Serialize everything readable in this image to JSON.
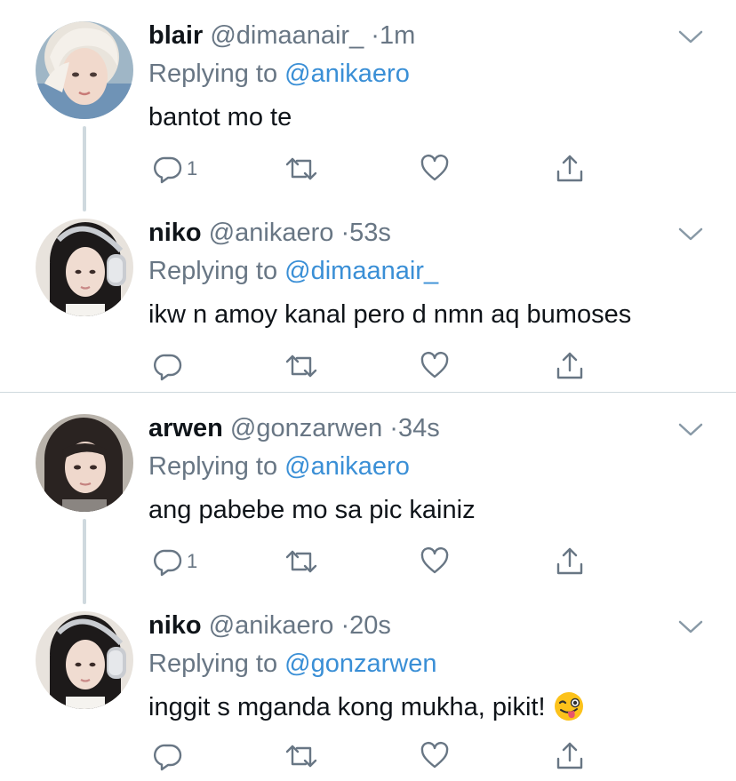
{
  "tweets": [
    {
      "name": "blair",
      "handle": "@dimaanair_",
      "dot": "·",
      "time": "1m",
      "replying_prefix": "Replying to ",
      "replying_to": "@anikaero",
      "text": "bantot mo te",
      "reply_count": "1"
    },
    {
      "name": "niko",
      "handle": "@anikaero",
      "dot": "·",
      "time": "53s",
      "replying_prefix": "Replying to ",
      "replying_to": "@dimaanair_",
      "text": "ikw n amoy kanal pero d nmn aq bumoses",
      "reply_count": ""
    },
    {
      "name": "arwen",
      "handle": "@gonzarwen",
      "dot": "·",
      "time": "34s",
      "replying_prefix": "Replying to ",
      "replying_to": "@anikaero",
      "text": "ang pabebe mo sa pic kainiz",
      "reply_count": "1"
    },
    {
      "name": "niko",
      "handle": "@anikaero",
      "dot": "·",
      "time": "20s",
      "replying_prefix": "Replying to ",
      "replying_to": "@gonzarwen",
      "text": "inggit s mganda kong mukha, pikit!",
      "reply_count": ""
    }
  ],
  "icons": {
    "reply": "reply-icon",
    "retweet": "retweet-icon",
    "like": "like-icon",
    "share": "share-icon",
    "more": "chevron-down-icon",
    "emoji": "winking-face-with-tongue-emoji"
  },
  "colors": {
    "text": "#0f1419",
    "secondary": "#687684",
    "mention": "#3a8fd6",
    "thread_line": "#cfd9de",
    "divider": "#cfd9de"
  }
}
